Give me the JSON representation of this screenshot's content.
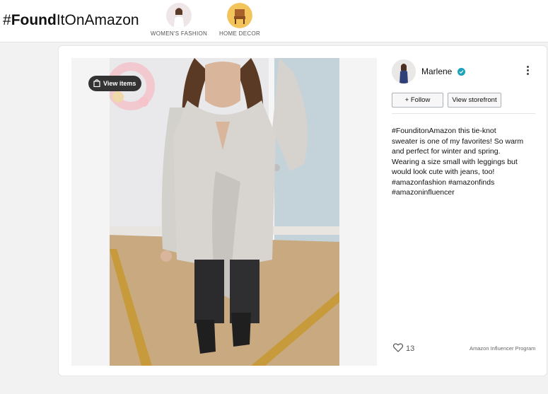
{
  "brand": {
    "hash": "#",
    "bold": "Found",
    "rest": "ItOnAmazon"
  },
  "categories": [
    {
      "label": "WOMEN'S FASHION",
      "icon": "fashion-thumbnail"
    },
    {
      "label": "HOME DECOR",
      "icon": "chair-thumbnail"
    }
  ],
  "post": {
    "view_items_label": "View items",
    "creator_name": "Marlene",
    "follow_label": "+ Follow",
    "storefront_label": "View storefront",
    "caption_lines": [
      "#FounditonAmazon this tie-knot",
      "sweater is one of my favorites! So warm",
      "and perfect for winter and spring.",
      "Wearing a size small with leggings but",
      "would look cute with jeans, too!",
      "#amazonfashion #amazonfinds",
      "#amazoninfluencer"
    ],
    "like_count": "13",
    "program_label": "Amazon Influencer Program"
  },
  "colors": {
    "verified": "#1aa3b8",
    "home_decor_circle": "#f3c35c",
    "view_items_bg": "#333333"
  }
}
